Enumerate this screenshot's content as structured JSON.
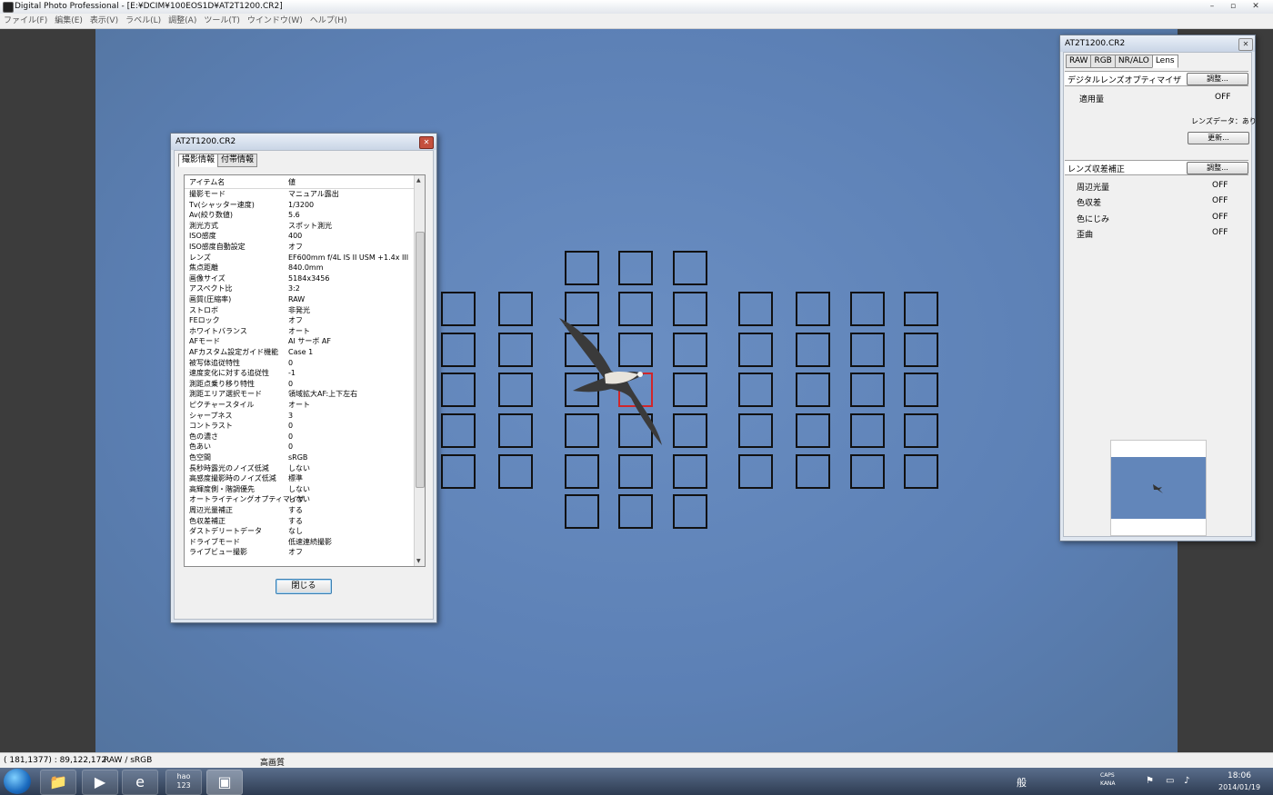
{
  "window": {
    "title": "Digital Photo Professional - [E:¥DCIM¥100EOS1D¥AT2T1200.CR2]",
    "minimize": "–",
    "maximize": "▫",
    "close": "✕"
  },
  "menu": [
    "ファイル(F)",
    "編集(E)",
    "表示(V)",
    "ラベル(L)",
    "調整(A)",
    "ツール(T)",
    "ウインドウ(W)",
    "ヘルプ(H)"
  ],
  "info_dialog": {
    "title": "AT2T1200.CR2",
    "tabs": [
      "撮影情報",
      "付帯情報"
    ],
    "active_tab": 0,
    "column_headers": [
      "アイテム名",
      "値"
    ],
    "rows": [
      [
        "撮影モード",
        "マニュアル露出"
      ],
      [
        "Tv(シャッター速度)",
        "1/3200"
      ],
      [
        "Av(絞り数値)",
        "5.6"
      ],
      [
        "測光方式",
        "スポット測光"
      ],
      [
        "ISO感度",
        "400"
      ],
      [
        "ISO感度自動設定",
        "オフ"
      ],
      [
        "レンズ",
        "EF600mm f/4L IS II USM +1.4x III"
      ],
      [
        "焦点距離",
        "840.0mm"
      ],
      [
        "画像サイズ",
        "5184x3456"
      ],
      [
        "アスペクト比",
        "3:2"
      ],
      [
        "画質(圧縮率)",
        "RAW"
      ],
      [
        "ストロボ",
        "非発光"
      ],
      [
        "FEロック",
        "オフ"
      ],
      [
        "ホワイトバランス",
        "オート"
      ],
      [
        "AFモード",
        "AI サーボ AF"
      ],
      [
        "AFカスタム設定ガイド機能",
        "Case 1"
      ],
      [
        "被写体追従特性",
        "0"
      ],
      [
        "速度変化に対する追従性",
        "-1"
      ],
      [
        "測距点乗り移り特性",
        "0"
      ],
      [
        "測距エリア選択モード",
        "領域拡大AF:上下左右"
      ],
      [
        "ピクチャースタイル",
        "オート"
      ],
      [
        "シャープネス",
        "3"
      ],
      [
        "コントラスト",
        "0"
      ],
      [
        "色の濃さ",
        "0"
      ],
      [
        "色あい",
        "0"
      ],
      [
        "色空間",
        "sRGB"
      ],
      [
        "長秒時露光のノイズ低減",
        "しない"
      ],
      [
        "高感度撮影時のノイズ低減",
        "標準"
      ],
      [
        "高輝度側・階調優先",
        "しない"
      ],
      [
        "オートライティングオプティマイザ",
        "しない"
      ],
      [
        "周辺光量補正",
        "する"
      ],
      [
        "色収差補正",
        "する"
      ],
      [
        "ダストデリートデータ",
        "なし"
      ],
      [
        "ドライブモード",
        "低速連続撮影"
      ],
      [
        "ライブビュー撮影",
        "オフ"
      ]
    ],
    "close_button": "閉じる"
  },
  "tool_palette": {
    "title": "AT2T1200.CR2",
    "tabs": [
      "RAW",
      "RGB",
      "NR/ALO",
      "Lens"
    ],
    "active_tab": 3,
    "dlo": {
      "label": "デジタルレンズオプティマイザ",
      "adjust_button": "調整...",
      "amount_label": "適用量",
      "amount_value": "OFF",
      "lens_data": "レンズデータ：あり",
      "update_button": "更新..."
    },
    "aberration": {
      "label": "レンズ収差補正",
      "adjust_button": "調整...",
      "items": [
        {
          "label": "周辺光量",
          "value": "OFF"
        },
        {
          "label": "色収差",
          "value": "OFF"
        },
        {
          "label": "色にじみ",
          "value": "OFF"
        },
        {
          "label": "歪曲",
          "value": "OFF"
        }
      ]
    }
  },
  "status_bar": {
    "coords": "( 181,1377) : 89,122,172",
    "color_mode": "RAW / sRGB",
    "quality": "高画質"
  },
  "taskbar": {
    "time": "18:06",
    "date": "2014/01/19",
    "caps": "CAPS",
    "kana": "KANA",
    "ime": "般",
    "app_hao": "hao\n123"
  },
  "colors": {
    "af_active": "#d0262a",
    "sky": "#5c80b5"
  }
}
